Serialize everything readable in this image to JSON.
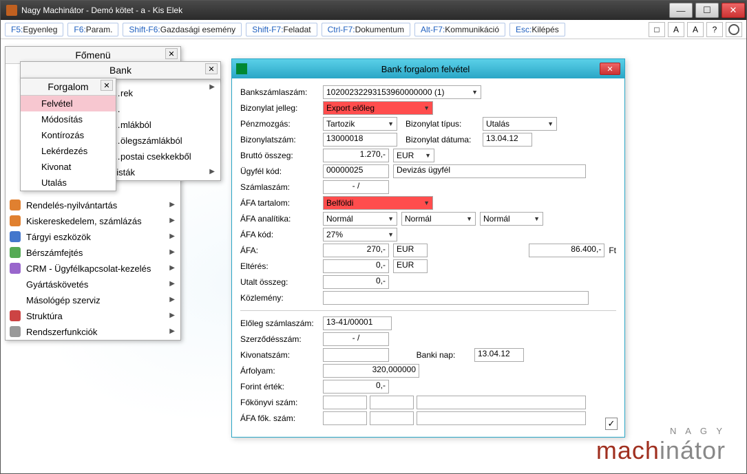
{
  "window_title": "Nagy Machinátor - Demó kötet - a - Kis Elek",
  "toolbar": [
    {
      "key": "F5:",
      "label": "Egyenleg"
    },
    {
      "key": "F6:",
      "label": "Param."
    },
    {
      "key": "Shift-F6:",
      "label": "Gazdasági esemény"
    },
    {
      "key": "Shift-F7:",
      "label": "Feladat"
    },
    {
      "key": "Ctrl-F7:",
      "label": "Dokumentum"
    },
    {
      "key": "Alt-F7:",
      "label": "Kommunikáció"
    },
    {
      "key": "Esc:",
      "label": "Kilépés"
    }
  ],
  "toolbar_icons": [
    "□",
    "A",
    "A",
    "?"
  ],
  "main_menu": {
    "title": "Főmenü",
    "items": [
      {
        "label": "…rek"
      },
      {
        "label": "…"
      },
      {
        "label": "…mlákból"
      },
      {
        "label": "…ölegszámlákból"
      },
      {
        "label": "…postai csekkekből"
      },
      {
        "label": "Listák",
        "arrow": true
      },
      {
        "label": "Rendelés-nyilvántartás",
        "arrow": true,
        "icon": "orange"
      },
      {
        "label": "Kiskereskedelem, számlázás",
        "arrow": true,
        "icon": "orange"
      },
      {
        "label": "Tárgyi eszközök",
        "arrow": true,
        "icon": "blue"
      },
      {
        "label": "Bérszámfejtés",
        "arrow": true,
        "icon": "green"
      },
      {
        "label": "CRM - Ügyfélkapcsolat-kezelés",
        "arrow": true,
        "icon": "purple"
      },
      {
        "label": "Gyártáskövetés",
        "arrow": true
      },
      {
        "label": "Másológép szerviz",
        "arrow": true
      },
      {
        "label": "Struktúra",
        "arrow": true,
        "icon": "red"
      },
      {
        "label": "Rendszerfunkciók",
        "arrow": true,
        "icon": "gray"
      }
    ]
  },
  "bank_menu": {
    "title": "Bank"
  },
  "forgalom_menu": {
    "title": "Forgalom",
    "items": [
      {
        "label": "Felvétel",
        "selected": true
      },
      {
        "label": "Módosítás"
      },
      {
        "label": "Kontírozás"
      },
      {
        "label": "Lekérdezés"
      },
      {
        "label": "Kivonat"
      },
      {
        "label": "Utalás"
      }
    ]
  },
  "form": {
    "title": "Bank forgalom felvétel",
    "labels": {
      "bankszamla": "Bankszámlaszám:",
      "bizjelleg": "Bizonylat jelleg:",
      "penzmozgas": "Pénzmozgás:",
      "biztipus": "Bizonylat típus:",
      "bizszam": "Bizonylatszám:",
      "bizdatum": "Bizonylat dátuma:",
      "brutto": "Bruttó összeg:",
      "ugyfelkod": "Ügyfél kód:",
      "szamlaszam": "Számlaszám:",
      "afatartalom": "ÁFA tartalom:",
      "afaanalitika": "ÁFA analítika:",
      "afakod": "ÁFA kód:",
      "afa": "ÁFA:",
      "elteres": "Eltérés:",
      "utalt": "Utalt összeg:",
      "kozlemeny": "Közlemény:",
      "eloleg": "Előleg számlaszám:",
      "szerzodes": "Szerződésszám:",
      "kivonat": "Kivonatszám:",
      "bankinap": "Banki nap:",
      "arfolyam": "Árfolyam:",
      "forint": "Forint érték:",
      "fokonyvi": "Főkönyvi szám:",
      "afafok": "ÁFA fők. szám:"
    },
    "values": {
      "bankszamla": "10200232293153960000000 (1)",
      "bizjelleg": "Export előleg",
      "penzmozgas": "Tartozik",
      "biztipus": "Utalás",
      "bizszam": "13000018",
      "bizdatum": "13.04.12",
      "brutto": "1.270,-",
      "brutto_cur": "EUR",
      "ugyfelkod": "00000025",
      "ugyfelnev": "Devizás ügyfél",
      "szamlaszam": "-  /",
      "afatartalom": "Belföldi",
      "afaanal1": "Normál",
      "afaanal2": "Normál",
      "afaanal3": "Normál",
      "afakod": "27%",
      "afa": "270,-",
      "afa_cur": "EUR",
      "afa_huf": "86.400,-",
      "afa_huf_unit": "Ft",
      "elteres": "0,-",
      "elteres_cur": "EUR",
      "utalt": "0,-",
      "kozlemeny": "",
      "eloleg": "13-41/00001",
      "szerzodes": "-  /",
      "kivonat": "",
      "bankinap": "13.04.12",
      "arfolyam": "320,000000",
      "forint": "0,-",
      "fokonyvi1": "",
      "fokonyvi2": "",
      "fokonyvi3": "",
      "afafok1": "",
      "afafok2": "",
      "afafok3": ""
    }
  },
  "logo": {
    "small": "N A G Y",
    "big1": "mach",
    "big2": "inátor"
  }
}
